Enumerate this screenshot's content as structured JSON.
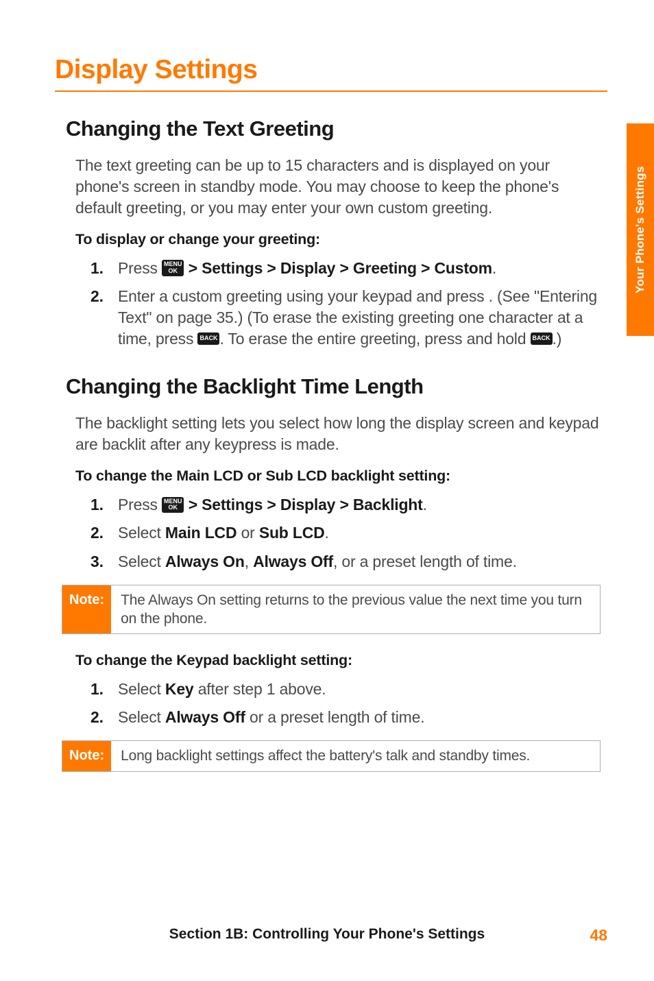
{
  "side_tab": "Your Phone's Settings",
  "main_title": "Display Settings",
  "sec1": {
    "heading": "Changing the Text Greeting",
    "intro": "The text greeting can be up to 15 characters and is displayed on your phone's screen in standby mode. You may choose to keep the phone's default greeting, or you may enter your own custom greeting.",
    "lead": "To display or change your greeting:",
    "steps": {
      "s1": {
        "num": "1.",
        "pre": "Press ",
        "bold": " > Settings > Display > Greeting > Custom",
        "post": "."
      },
      "s2": {
        "num": "2.",
        "a": "Enter a custom greeting using your keypad and press . (See \"Entering Text\" on page 35.) (To erase the existing greeting one character at a time, press ",
        "b": ". To erase the entire greeting, press and hold ",
        "c": ".)"
      }
    }
  },
  "sec2": {
    "heading": "Changing the Backlight Time Length",
    "intro": "The backlight setting lets you select how long the display screen and keypad are backlit after any keypress is made.",
    "lead": "To change the Main LCD or Sub LCD backlight setting:",
    "steps": {
      "s1": {
        "num": "1.",
        "pre": "Press ",
        "bold": " > Settings > Display > Backlight",
        "post": "."
      },
      "s2": {
        "num": "2.",
        "pre": "Select ",
        "b1": "Main LCD",
        "mid": " or ",
        "b2": "Sub LCD",
        "post": "."
      },
      "s3": {
        "num": "3.",
        "pre": "Select ",
        "b1": "Always On",
        "c1": ", ",
        "b2": "Always Off",
        "post": ", or a preset length of time."
      }
    },
    "note1_label": "Note:",
    "note1_text": "The Always On setting returns to the previous value the next time you turn on the phone.",
    "lead2": "To change the Keypad backlight setting:",
    "steps2": {
      "s1": {
        "num": "1.",
        "pre": "Select ",
        "b1": "Key",
        "post": " after step 1 above."
      },
      "s2": {
        "num": "2.",
        "pre": "Select ",
        "b1": "Always Off",
        "post": " or a preset length of time."
      }
    },
    "note2_label": "Note:",
    "note2_text": "Long backlight settings affect the battery's talk and standby times."
  },
  "footer": {
    "text": "Section 1B: Controlling Your Phone's Settings",
    "page": "48"
  },
  "icons": {
    "menu_l1": "MENU",
    "menu_l2": "OK",
    "back": "BACK"
  }
}
